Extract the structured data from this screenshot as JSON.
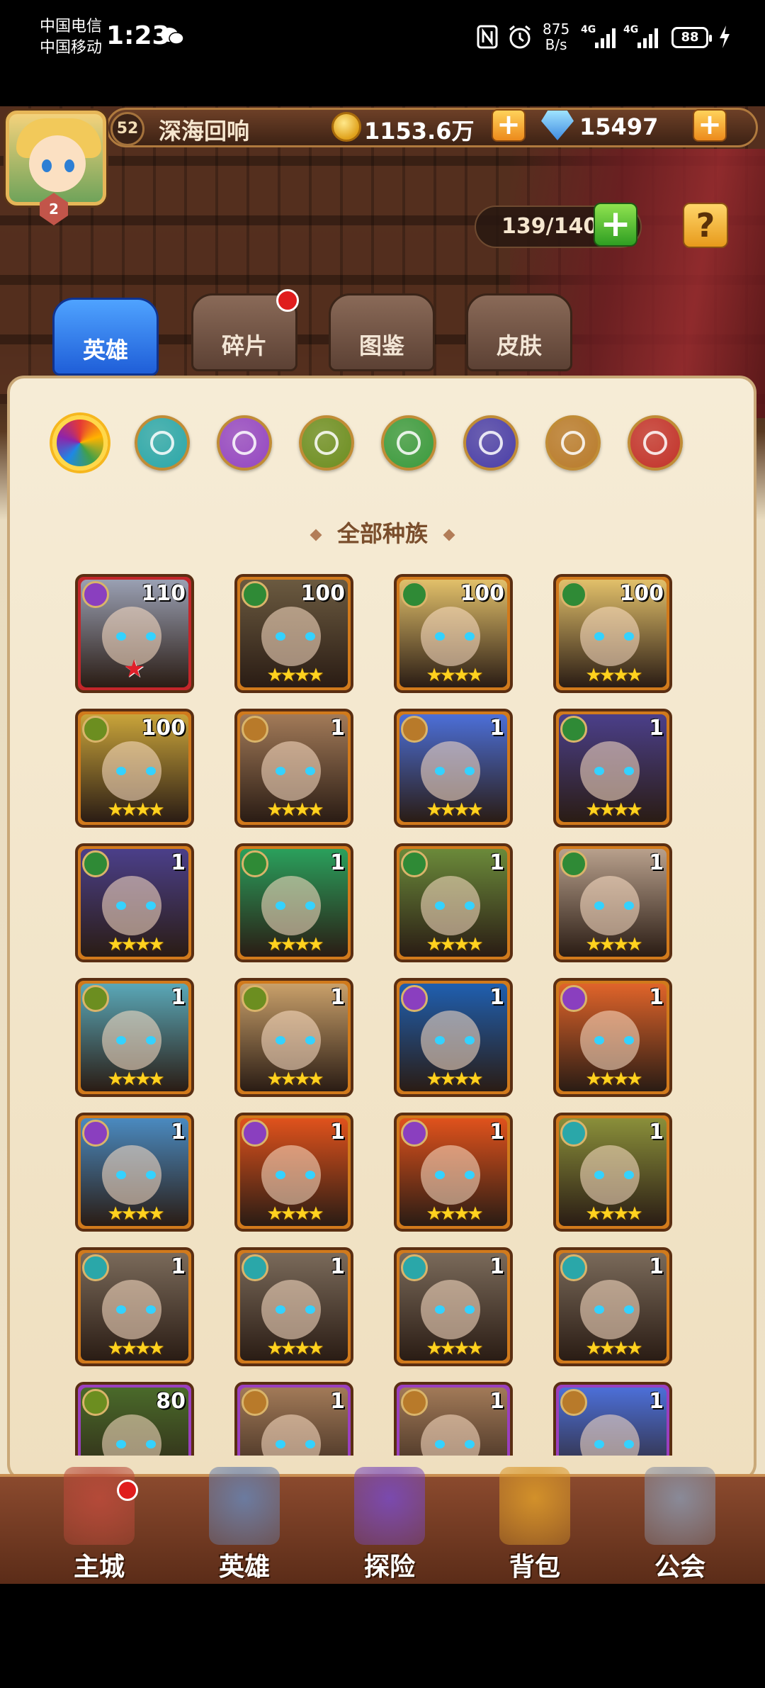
{
  "status_bar": {
    "carrier1": "中国电信",
    "carrier2": "中国移动",
    "time": "1:23",
    "net_speed_value": "875",
    "net_speed_unit": "B/s",
    "signal1_label": "4G",
    "signal2_label": "4G",
    "battery": "88"
  },
  "player": {
    "vip": "2",
    "level": "52",
    "name": "深海回响",
    "gold": "1153.6万",
    "gems": "15497"
  },
  "roster": {
    "capacity": "139/140",
    "help_icon": "?"
  },
  "tabs": [
    {
      "label": "英雄"
    },
    {
      "label": "碎片"
    },
    {
      "label": "图鉴"
    },
    {
      "label": "皮肤"
    }
  ],
  "factions": [
    {
      "icon": "all-factions-icon",
      "color": "#ffb33a"
    },
    {
      "icon": "water-faction-icon",
      "color": "#2aa7a9"
    },
    {
      "icon": "shadow-faction-icon",
      "color": "#9446c2"
    },
    {
      "icon": "light-faction-icon",
      "color": "#6c8e20"
    },
    {
      "icon": "nature-faction-icon",
      "color": "#3a9a3d"
    },
    {
      "icon": "demon-faction-icon",
      "color": "#4a3ea8"
    },
    {
      "icon": "holy-faction-icon",
      "color": "#b87a2a"
    },
    {
      "icon": "fire-faction-icon",
      "color": "#c2322a"
    }
  ],
  "race_header": "全部种族",
  "heroes": [
    {
      "level": "110",
      "faction_color": "#8a3fbf",
      "frame": "#c3262a",
      "portrait": "#9aa0b3",
      "stars": "",
      "red_star": "★"
    },
    {
      "level": "100",
      "faction_color": "#2f8a36",
      "frame": "#d17a1c",
      "portrait": "#6b5a40",
      "stars": "★★★★"
    },
    {
      "level": "100",
      "faction_color": "#2f8a36",
      "frame": "#d17a1c",
      "portrait": "#e2c06a",
      "stars": "★★★★"
    },
    {
      "level": "100",
      "faction_color": "#2f8a36",
      "frame": "#d17a1c",
      "portrait": "#e2c06a",
      "stars": "★★★★"
    },
    {
      "level": "100",
      "faction_color": "#6c8e20",
      "frame": "#d17a1c",
      "portrait": "#c9a43a",
      "stars": "★★★★"
    },
    {
      "level": "1",
      "faction_color": "#b87a2a",
      "frame": "#d17a1c",
      "portrait": "#a27a58",
      "stars": "★★★★"
    },
    {
      "level": "1",
      "faction_color": "#b87a2a",
      "frame": "#d17a1c",
      "portrait": "#4c6fd8",
      "stars": "★★★★"
    },
    {
      "level": "1",
      "faction_color": "#2f8a36",
      "frame": "#d17a1c",
      "portrait": "#4b3f8a",
      "stars": "★★★★"
    },
    {
      "level": "1",
      "faction_color": "#2f8a36",
      "frame": "#d17a1c",
      "portrait": "#4b3f8a",
      "stars": "★★★★"
    },
    {
      "level": "1",
      "faction_color": "#2f8a36",
      "frame": "#d17a1c",
      "portrait": "#2aa05c",
      "stars": "★★★★"
    },
    {
      "level": "1",
      "faction_color": "#2f8a36",
      "frame": "#d17a1c",
      "portrait": "#6b8a3a",
      "stars": "★★★★"
    },
    {
      "level": "1",
      "faction_color": "#2f8a36",
      "frame": "#d17a1c",
      "portrait": "#b8a08c",
      "stars": "★★★★"
    },
    {
      "level": "1",
      "faction_color": "#6c8e20",
      "frame": "#d17a1c",
      "portrait": "#5aa8b8",
      "stars": "★★★★"
    },
    {
      "level": "1",
      "faction_color": "#6c8e20",
      "frame": "#d17a1c",
      "portrait": "#c9a06a",
      "stars": "★★★★"
    },
    {
      "level": "1",
      "faction_color": "#8a3fbf",
      "frame": "#d17a1c",
      "portrait": "#1f5fb0",
      "stars": "★★★★"
    },
    {
      "level": "1",
      "faction_color": "#8a3fbf",
      "frame": "#d17a1c",
      "portrait": "#e0642a",
      "stars": "★★★★"
    },
    {
      "level": "1",
      "faction_color": "#8a3fbf",
      "frame": "#d17a1c",
      "portrait": "#4a8ac0",
      "stars": "★★★★"
    },
    {
      "level": "1",
      "faction_color": "#8a3fbf",
      "frame": "#d17a1c",
      "portrait": "#e0521c",
      "stars": "★★★★"
    },
    {
      "level": "1",
      "faction_color": "#8a3fbf",
      "frame": "#d17a1c",
      "portrait": "#e0521c",
      "stars": "★★★★"
    },
    {
      "level": "1",
      "faction_color": "#2aa7a9",
      "frame": "#d17a1c",
      "portrait": "#8a8f3a",
      "stars": "★★★★"
    },
    {
      "level": "1",
      "faction_color": "#2aa7a9",
      "frame": "#d17a1c",
      "portrait": "#7a6a5a",
      "stars": "★★★★"
    },
    {
      "level": "1",
      "faction_color": "#2aa7a9",
      "frame": "#d17a1c",
      "portrait": "#7a6a5a",
      "stars": "★★★★"
    },
    {
      "level": "1",
      "faction_color": "#2aa7a9",
      "frame": "#d17a1c",
      "portrait": "#7a6a5a",
      "stars": "★★★★"
    },
    {
      "level": "1",
      "faction_color": "#2aa7a9",
      "frame": "#d17a1c",
      "portrait": "#7a6a5a",
      "stars": "★★★★"
    },
    {
      "level": "80",
      "faction_color": "#6c8e20",
      "frame": "#9a3fbf",
      "portrait": "#4a6a2a",
      "stars": ""
    },
    {
      "level": "1",
      "faction_color": "#b87a2a",
      "frame": "#9a3fbf",
      "portrait": "#a27a58",
      "stars": ""
    },
    {
      "level": "1",
      "faction_color": "#b87a2a",
      "frame": "#9a3fbf",
      "portrait": "#a27a58",
      "stars": ""
    },
    {
      "level": "1",
      "faction_color": "#b87a2a",
      "frame": "#9a3fbf",
      "portrait": "#4c6fd8",
      "stars": ""
    }
  ],
  "nav": [
    {
      "label": "主城",
      "icon": "castle-icon",
      "color": "#b84a3a"
    },
    {
      "label": "英雄",
      "icon": "hero-icon",
      "color": "#6a7fa8"
    },
    {
      "label": "探险",
      "icon": "portal-icon",
      "color": "#7a4ab8"
    },
    {
      "label": "背包",
      "icon": "backpack-icon",
      "color": "#d8962a"
    },
    {
      "label": "公会",
      "icon": "guild-tower-icon",
      "color": "#8a8fa0"
    }
  ]
}
